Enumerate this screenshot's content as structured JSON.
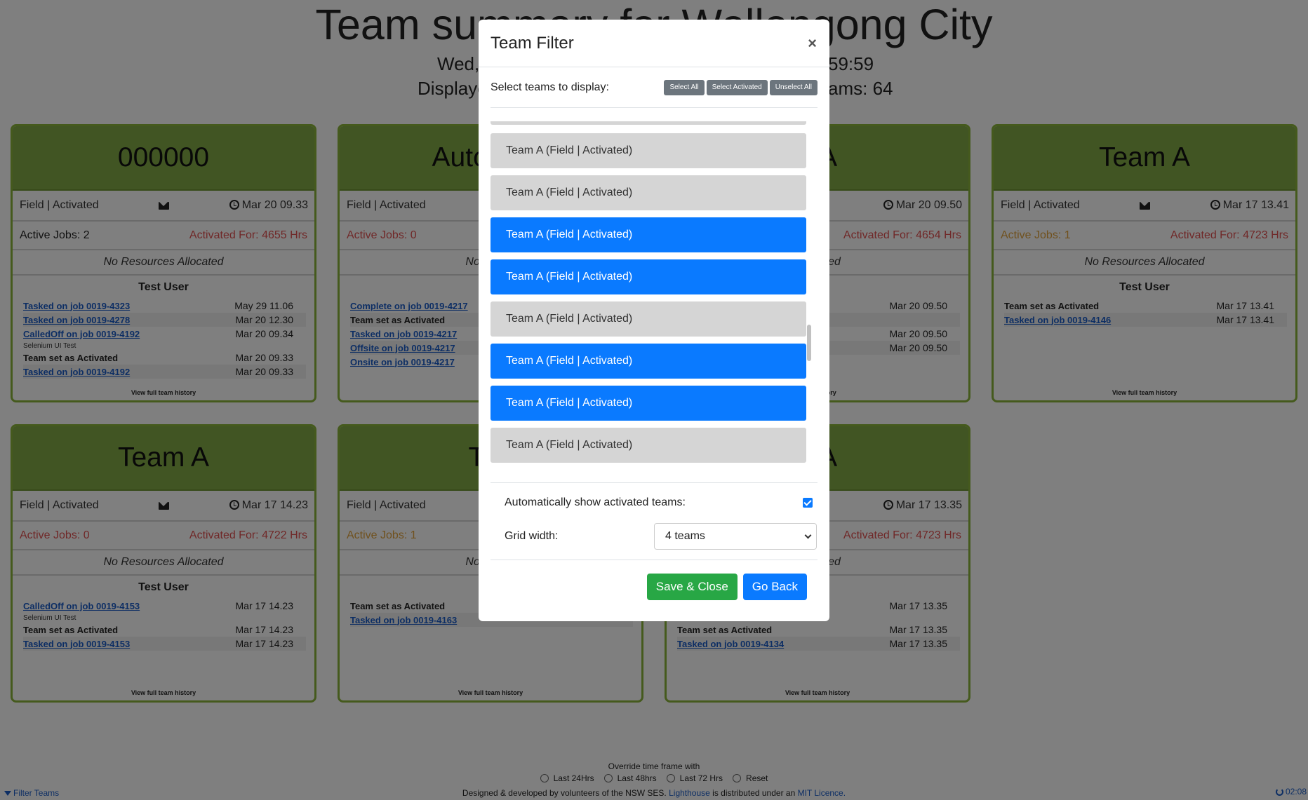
{
  "page": {
    "title": "Team summary for Wollongong City",
    "date_line": "Wed, 0… 59:59",
    "date_left": "Wed,",
    "date_right": "59:59",
    "displayed_left": "Displaye",
    "displayed_right": "ams: 64"
  },
  "cards": [
    {
      "name": "000000",
      "status": "Field | Activated",
      "time": "Mar 20 09.33",
      "active_jobs": "Active Jobs: 2",
      "activated_for": "Activated For: 4655 Hrs",
      "resources": "No Resources Allocated",
      "user": "Test User",
      "history": [
        {
          "text": "Tasked on job 0019-4323",
          "date": "May 29 11.06",
          "type": "link"
        },
        {
          "text": "Tasked on job 0019-4278",
          "date": "Mar 20 12.30",
          "type": "link"
        },
        {
          "text": "CalledOff on job 0019-4192",
          "date": "Mar 20 09.34",
          "type": "link"
        },
        {
          "text": "Selenium UI Test",
          "date": "",
          "type": "note"
        },
        {
          "text": "Team set as Activated",
          "date": "Mar 20 09.33",
          "type": "bold"
        },
        {
          "text": "Tasked on job 0019-4192",
          "date": "Mar 20 09.33",
          "type": "link"
        }
      ],
      "view": "View full team history"
    },
    {
      "name": "Automate",
      "status": "Field | Activated",
      "time": "",
      "active_jobs": "Active Jobs: 0",
      "activated_for": "",
      "resources": "No Resou",
      "user": "Tes",
      "history": [
        {
          "text": "Complete on job 0019-4217",
          "date": "",
          "type": "link"
        },
        {
          "text": "Team set as Activated",
          "date": "",
          "type": "bold"
        },
        {
          "text": "Tasked on job 0019-4217",
          "date": "",
          "type": "link"
        },
        {
          "text": "Offsite on job 0019-4217",
          "date": "",
          "type": "link"
        },
        {
          "text": "Onsite on job 0019-4217",
          "date": "",
          "type": "link"
        }
      ],
      "view": "Vie"
    },
    {
      "name": "n A",
      "status": "",
      "time": "Mar 20 09.50",
      "active_jobs": "",
      "activated_for": "Activated For: 4654 Hrs",
      "resources": "Allocated",
      "user": "ser",
      "history": [
        {
          "text": "",
          "date": "Mar 20 09.50",
          "type": "link"
        },
        {
          "text": "",
          "date": "",
          "type": "link"
        },
        {
          "text": "",
          "date": "Mar 20 09.50",
          "type": "link"
        },
        {
          "text": "",
          "date": "Mar 20 09.50",
          "type": "link"
        }
      ],
      "view": "team history"
    },
    {
      "name": "Team A",
      "status": "Field | Activated",
      "time": "Mar 17 13.41",
      "active_jobs": "Active Jobs: 1",
      "activated_for": "Activated For: 4723 Hrs",
      "resources": "No Resources Allocated",
      "user": "Test User",
      "history": [
        {
          "text": "Team set as Activated",
          "date": "Mar 17 13.41",
          "type": "bold"
        },
        {
          "text": "Tasked on job 0019-4146",
          "date": "Mar 17 13.41",
          "type": "link"
        }
      ],
      "view": "View full team history"
    },
    {
      "name": "Team A",
      "status": "Field | Activated",
      "time": "Mar 17 14.23",
      "active_jobs": "Active Jobs: 0",
      "activated_for": "Activated For: 4722 Hrs",
      "resources": "No Resources Allocated",
      "user": "Test User",
      "history": [
        {
          "text": "CalledOff on job 0019-4153",
          "date": "Mar 17 14.23",
          "type": "link"
        },
        {
          "text": "Selenium UI Test",
          "date": "",
          "type": "note"
        },
        {
          "text": "Team set as Activated",
          "date": "Mar 17 14.23",
          "type": "bold"
        },
        {
          "text": "Tasked on job 0019-4153",
          "date": "Mar 17 14.23",
          "type": "link"
        }
      ],
      "view": "View full team history"
    },
    {
      "name": "Tea",
      "status": "Field | Activated",
      "time": "",
      "active_jobs": "Active Jobs: 1",
      "activated_for": "",
      "resources": "No Resou",
      "user": "Tes",
      "history": [
        {
          "text": "Team set as Activated",
          "date": "",
          "type": "bold"
        },
        {
          "text": "Tasked on job 0019-4163",
          "date": "",
          "type": "link"
        }
      ],
      "view": "View full team history"
    },
    {
      "name": "n A",
      "status": "",
      "time": "Mar 17 13.35",
      "active_jobs": "",
      "activated_for": "Activated For: 4723 Hrs",
      "resources": "Allocated",
      "user": "ser",
      "history": [
        {
          "text": "",
          "date": "Mar 17 13.35",
          "type": "link"
        },
        {
          "text": "",
          "date": "",
          "type": "note"
        },
        {
          "text": "Team set as Activated",
          "date": "Mar 17 13.35",
          "type": "bold"
        },
        {
          "text": "Tasked on job 0019-4134",
          "date": "Mar 17 13.35",
          "type": "link"
        }
      ],
      "view": "View full team history"
    }
  ],
  "modal": {
    "title": "Team Filter",
    "close": "×",
    "select_label": "Select teams to display:",
    "select_all": "Select All",
    "select_activated": "Select Activated",
    "unselect_all": "Unselect All",
    "teams": [
      {
        "label": "Team A (Field | Activated)",
        "selected": false
      },
      {
        "label": "Team A (Field | Activated)",
        "selected": false
      },
      {
        "label": "Team A (Field | Activated)",
        "selected": true
      },
      {
        "label": "Team A (Field | Activated)",
        "selected": true
      },
      {
        "label": "Team A (Field | Activated)",
        "selected": false
      },
      {
        "label": "Team A (Field | Activated)",
        "selected": true
      },
      {
        "label": "Team A (Field | Activated)",
        "selected": true
      },
      {
        "label": "Team A (Field | Activated)",
        "selected": false
      }
    ],
    "auto_show_label": "Automatically show activated teams:",
    "auto_show_checked": true,
    "grid_label": "Grid width:",
    "grid_value": "4 teams",
    "save_close": "Save & Close",
    "go_back": "Go Back"
  },
  "footer": {
    "override": "Override time frame with",
    "radios": [
      "Last 24Hrs",
      "Last 48hrs",
      "Last 72 Hrs",
      "Reset"
    ],
    "credit_pre": "Designed & developed by volunteers of the NSW SES.",
    "credit_link1": "Lighthouse",
    "credit_mid": "is distributed under an",
    "credit_link2": "MIT Licence.",
    "filter_teams": "Filter Teams",
    "clock": "02:08"
  },
  "colors": {
    "card_header": "#83aa47",
    "selected_team": "#0a7aff",
    "unselected_team": "#d5d5d5",
    "save_button": "#28a745",
    "activated_for": "#e05050",
    "active_jobs_warn": "#e0a23c"
  }
}
